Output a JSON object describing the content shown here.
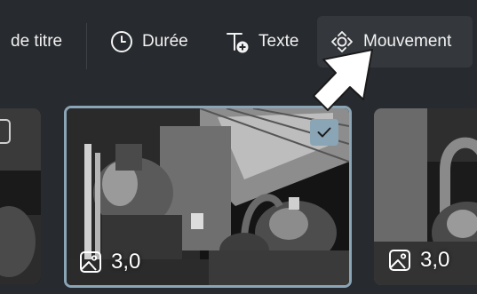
{
  "toolbar": {
    "title_partial_label": "de titre",
    "duration_label": "Durée",
    "text_label": "Texte",
    "motion_label": "Mouvement",
    "icons": [
      "clock-icon",
      "text-add-icon",
      "motion-icon"
    ]
  },
  "filmstrip": {
    "clips": [
      {
        "name": "clip-left",
        "selected": false,
        "duration": ""
      },
      {
        "name": "clip-selected",
        "selected": true,
        "duration": "3,0"
      },
      {
        "name": "clip-right",
        "selected": false,
        "duration": "3,0"
      }
    ]
  },
  "colors": {
    "background": "#272a2e",
    "active_tool": "#34383d",
    "selection_border": "#8aa5b6",
    "text": "#f2f2f2"
  }
}
